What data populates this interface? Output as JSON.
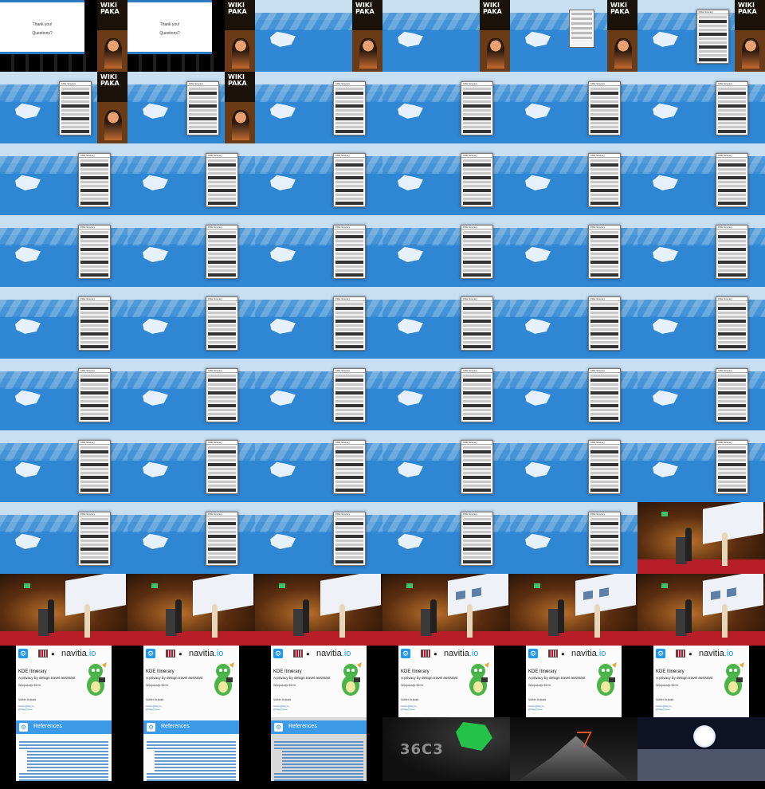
{
  "grid": {
    "columns": 6,
    "rows": 11
  },
  "texts": {
    "thank_you": "Thank you!",
    "questions": "Questions?",
    "wiki_logo_line1": "WIKI",
    "wiki_logo_line2": "PAKA",
    "app_name": "KDE Itinerary",
    "slide_logo_partner": "navitia",
    "slide_logo_partner_tld": ".io",
    "slide_title": "KDE Itinerary",
    "slide_subtitle": "A privacy by design travel assistant",
    "slide_event": "Wikipaka@ 36C3",
    "slide_author": "Volker Krause",
    "slide_link1": "vkrause@kde.org",
    "slide_link2": "@VolkerKrause",
    "references_title": "References",
    "c3_card_text": "36C3"
  },
  "tiles": [
    {
      "type": "thankyou"
    },
    {
      "type": "thankyou"
    },
    {
      "type": "desktop",
      "phone": false,
      "thumb": true
    },
    {
      "type": "desktop",
      "phone": false,
      "thumb": true
    },
    {
      "type": "desktop",
      "dialog": true,
      "thumb": true
    },
    {
      "type": "desktop",
      "phone_at": 74,
      "thumb": true
    },
    {
      "type": "desktop",
      "phone_at": 74,
      "thumb": true
    },
    {
      "type": "desktop",
      "phone_at": 74,
      "thumb": true
    },
    {
      "type": "desktop",
      "phone_at": 98
    },
    {
      "type": "desktop",
      "phone_at": 98
    },
    {
      "type": "desktop",
      "phone_at": 98
    },
    {
      "type": "desktop",
      "phone_at": 98
    },
    {
      "type": "desktop",
      "phone_at": 98
    },
    {
      "type": "desktop",
      "phone_at": 98
    },
    {
      "type": "desktop",
      "phone_at": 98
    },
    {
      "type": "desktop",
      "phone_at": 98
    },
    {
      "type": "desktop",
      "phone_at": 98
    },
    {
      "type": "desktop",
      "phone_at": 98
    },
    {
      "type": "desktop",
      "phone_at": 98
    },
    {
      "type": "desktop",
      "phone_at": 98
    },
    {
      "type": "desktop",
      "phone_at": 98
    },
    {
      "type": "desktop",
      "phone_at": 98
    },
    {
      "type": "desktop",
      "phone_at": 98
    },
    {
      "type": "desktop",
      "phone_at": 98
    },
    {
      "type": "desktop",
      "phone_at": 98
    },
    {
      "type": "desktop",
      "phone_at": 98
    },
    {
      "type": "desktop",
      "phone_at": 98
    },
    {
      "type": "desktop",
      "phone_at": 98
    },
    {
      "type": "desktop",
      "phone_at": 98
    },
    {
      "type": "desktop",
      "phone_at": 98
    },
    {
      "type": "desktop",
      "phone_at": 98
    },
    {
      "type": "desktop",
      "phone_at": 98
    },
    {
      "type": "desktop",
      "phone_at": 98
    },
    {
      "type": "desktop",
      "phone_at": 98
    },
    {
      "type": "desktop",
      "phone_at": 98
    },
    {
      "type": "desktop",
      "phone_at": 98
    },
    {
      "type": "desktop",
      "phone_at": 98
    },
    {
      "type": "desktop",
      "phone_at": 98
    },
    {
      "type": "desktop",
      "phone_at": 98
    },
    {
      "type": "desktop",
      "phone_at": 98
    },
    {
      "type": "desktop",
      "phone_at": 98
    },
    {
      "type": "desktop",
      "phone_at": 98
    },
    {
      "type": "desktop",
      "phone_at": 98
    },
    {
      "type": "desktop",
      "phone_at": 98
    },
    {
      "type": "desktop",
      "phone_at": 98
    },
    {
      "type": "desktop",
      "phone_at": 98
    },
    {
      "type": "desktop",
      "phone_at": 98
    },
    {
      "type": "stage",
      "slide": false
    },
    {
      "type": "stage",
      "slide": false
    },
    {
      "type": "stage",
      "slide": false
    },
    {
      "type": "stage",
      "slide": false
    },
    {
      "type": "stage",
      "slide": true
    },
    {
      "type": "stage",
      "slide": true
    },
    {
      "type": "stage",
      "slide": true
    },
    {
      "type": "title"
    },
    {
      "type": "title"
    },
    {
      "type": "title"
    },
    {
      "type": "title"
    },
    {
      "type": "title"
    },
    {
      "type": "title"
    },
    {
      "type": "references"
    },
    {
      "type": "references"
    },
    {
      "type": "references",
      "grey": true
    },
    {
      "type": "c3_logo"
    },
    {
      "type": "c3_mountain"
    },
    {
      "type": "c3_moon"
    }
  ],
  "colors": {
    "kde_blue": "#1d99f3",
    "slide_header_blue": "#3c9ae6",
    "stage_floor_red": "#b81e2a",
    "link_blue": "#2f7bc1"
  },
  "icons": [
    "kde-logo-icon",
    "db-logo-icon",
    "github-octocat-icon",
    "konqi-mascot-icon"
  ]
}
